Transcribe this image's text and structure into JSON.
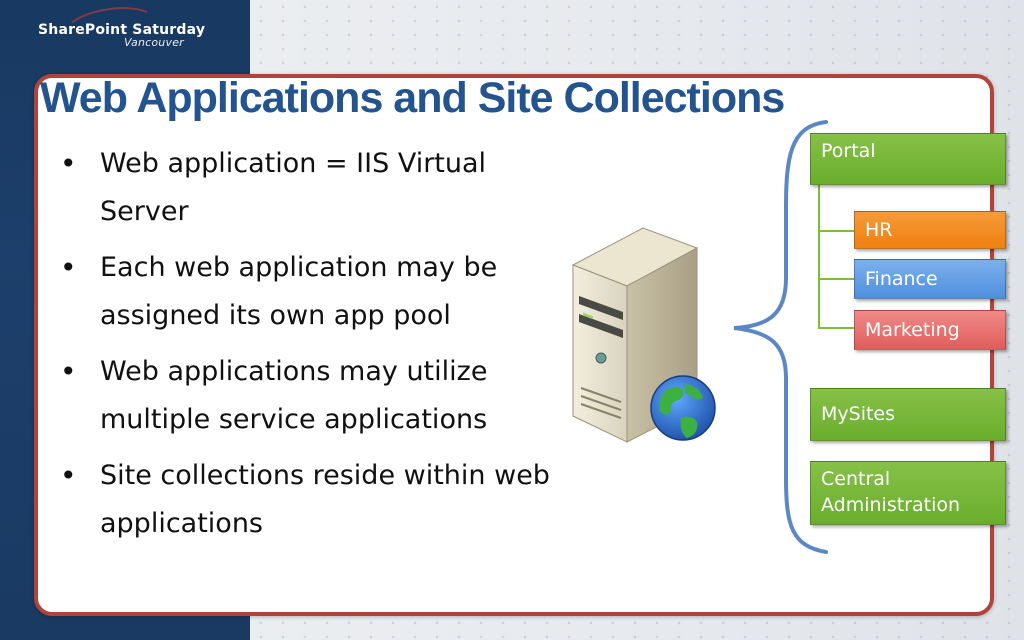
{
  "header": {
    "logo_name": "SharePoint Saturday",
    "logo_city": "Vancouver"
  },
  "slide": {
    "title": "Web Applications and Site Collections",
    "bullets": [
      "Web application = IIS Virtual Server",
      "Each web application may be assigned its own app pool",
      "Web applications may utilize multiple service applications",
      "Site collections reside within web applications"
    ]
  },
  "diagram": {
    "portal": "Portal",
    "hr": "HR",
    "finance": "Finance",
    "marketing": "Marketing",
    "mysites": "MySites",
    "central_admin": "Central Administration"
  },
  "colors": {
    "title": "#24548f",
    "frame": "#b0443a",
    "left_band": "#1a3a63",
    "green_box": "#6aad2c",
    "orange_box": "#ef7f10",
    "blue_box": "#4f8fdf",
    "red_box": "#e05d5b"
  },
  "icons": [
    "server-icon",
    "globe-icon",
    "brace-icon"
  ]
}
